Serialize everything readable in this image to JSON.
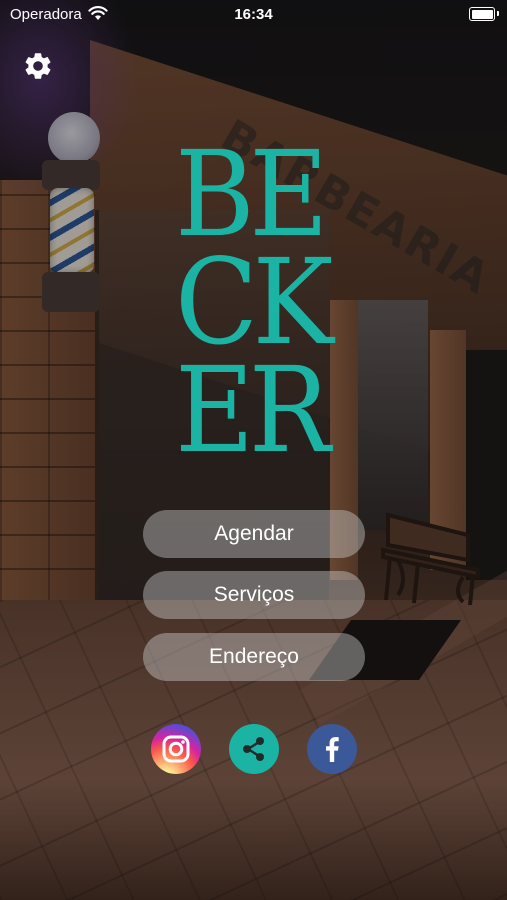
{
  "status_bar": {
    "carrier": "Operadora",
    "time": "16:34"
  },
  "settings": {
    "icon": "gear-icon"
  },
  "logo": {
    "lines": [
      "BE",
      "CK",
      "ER"
    ],
    "color": "#1bb3a3"
  },
  "background": {
    "sign_text": "BARBEARIA"
  },
  "menu": {
    "agendar_label": "Agendar",
    "servicos_label": "Serviços",
    "endereco_label": "Endereço"
  },
  "social": [
    {
      "name": "instagram",
      "icon": "instagram-icon"
    },
    {
      "name": "share",
      "icon": "share-icon",
      "color": "#1bb3a3"
    },
    {
      "name": "facebook",
      "icon": "facebook-icon",
      "color": "#3b5998"
    }
  ]
}
